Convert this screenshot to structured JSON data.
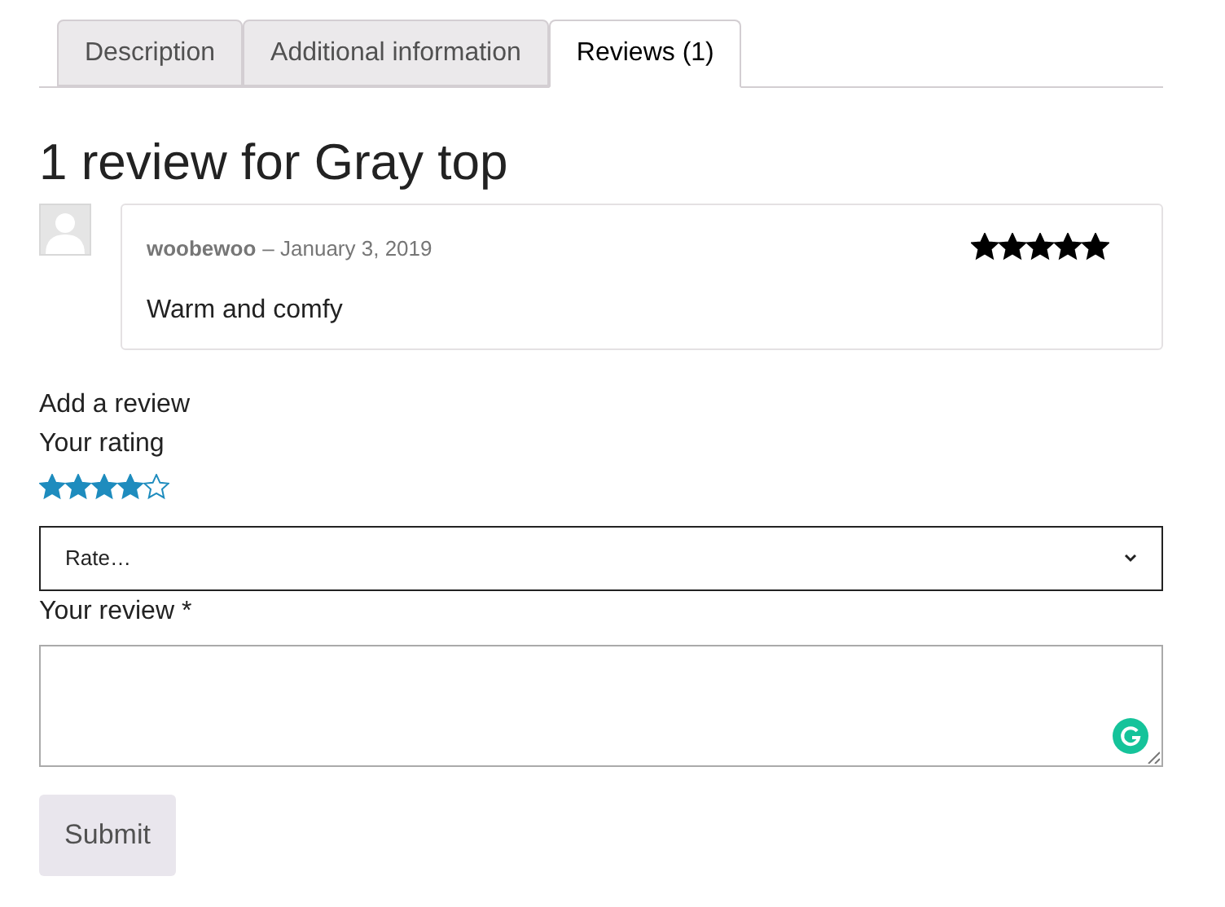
{
  "tabs": [
    {
      "label": "Description",
      "selected": false
    },
    {
      "label": "Additional information",
      "selected": false
    },
    {
      "label": "Reviews (1)",
      "selected": true
    }
  ],
  "heading": "1 review for Gray top",
  "review": {
    "author": "woobewoo",
    "date": "– January 3, 2019",
    "stars": 5,
    "text": "Warm and comfy"
  },
  "form": {
    "title": "Add a review",
    "rating_label": "Your rating",
    "stars": 4,
    "select": {
      "value": "Rate…"
    },
    "review_label": "Your review *",
    "submit": "Submit"
  }
}
